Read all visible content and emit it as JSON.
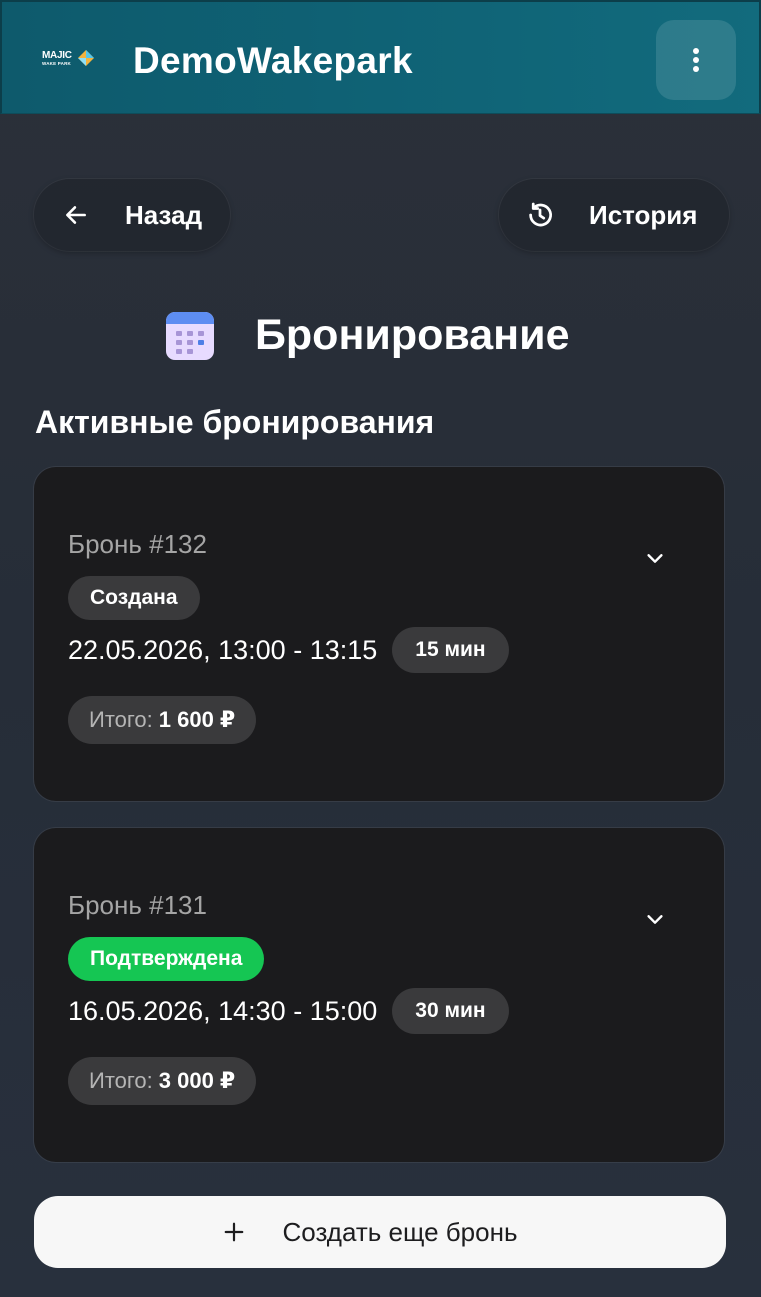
{
  "header": {
    "logo_text": "MAJIC",
    "logo_subtext": "WAKE PARK",
    "title": "DemoWakepark",
    "menu_icon": "more-vertical-icon"
  },
  "nav": {
    "back_label": "Назад",
    "back_icon": "arrow-left-icon",
    "history_label": "История",
    "history_icon": "history-icon"
  },
  "page": {
    "title": "Бронирование",
    "title_icon": "calendar-icon"
  },
  "section_title": "Активные бронирования",
  "bookings": [
    {
      "title": "Бронь #132",
      "status": "Создана",
      "status_color": "#3a3a3c",
      "time": "22.05.2026, 13:00 - 13:15",
      "duration": "15 мин",
      "total_label": "Итого:",
      "total_value": "1 600 ₽"
    },
    {
      "title": "Бронь #131",
      "status": "Подтверждена",
      "status_color": "#15c653",
      "time": "16.05.2026, 14:30 - 15:00",
      "duration": "30 мин",
      "total_label": "Итого:",
      "total_value": "3 000 ₽"
    }
  ],
  "create_button": {
    "label": "Создать еще бронь",
    "icon": "plus-icon"
  },
  "colors": {
    "header": "#0f6275",
    "card": "#1b1b1d",
    "confirmed": "#15c653"
  }
}
